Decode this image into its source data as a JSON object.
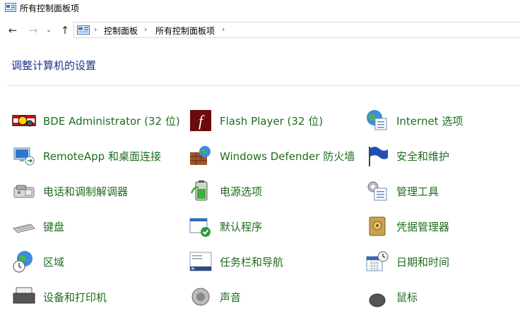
{
  "window": {
    "title": "所有控制面板项"
  },
  "address": {
    "crumbs": [
      "控制面板",
      "所有控制面板项"
    ]
  },
  "heading": "调整计算机的设置",
  "items": [
    {
      "label": "BDE Administrator (32 位)",
      "icon": "bde-admin-icon"
    },
    {
      "label": "Flash Player (32 位)",
      "icon": "flash-player-icon"
    },
    {
      "label": "Internet 选项",
      "icon": "internet-options-icon"
    },
    {
      "label": "RemoteApp 和桌面连接",
      "icon": "remote-desktop-icon"
    },
    {
      "label": "Windows Defender 防火墙",
      "icon": "firewall-icon"
    },
    {
      "label": "安全和维护",
      "icon": "flag-icon"
    },
    {
      "label": "电话和调制解调器",
      "icon": "phone-modem-icon"
    },
    {
      "label": "电源选项",
      "icon": "battery-icon"
    },
    {
      "label": "管理工具",
      "icon": "admin-tools-icon"
    },
    {
      "label": "键盘",
      "icon": "keyboard-icon"
    },
    {
      "label": "默认程序",
      "icon": "default-programs-icon"
    },
    {
      "label": "凭据管理器",
      "icon": "credential-vault-icon"
    },
    {
      "label": "区域",
      "icon": "globe-clock-icon"
    },
    {
      "label": "任务栏和导航",
      "icon": "taskbar-icon"
    },
    {
      "label": "日期和时间",
      "icon": "calendar-clock-icon"
    },
    {
      "label": "设备和打印机",
      "icon": "printer-icon"
    },
    {
      "label": "声音",
      "icon": "speaker-icon"
    },
    {
      "label": "鼠标",
      "icon": "mouse-icon"
    }
  ]
}
